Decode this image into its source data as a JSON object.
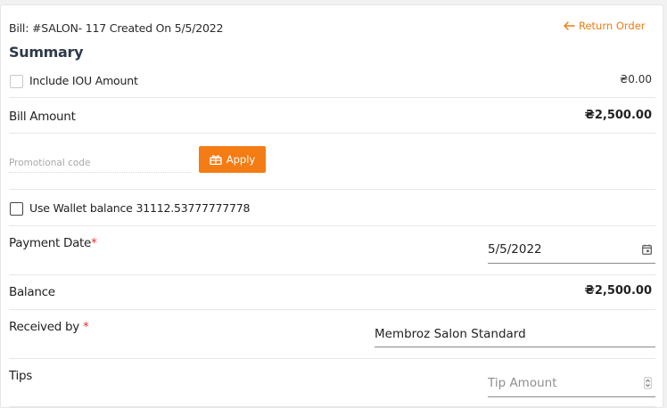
{
  "header": {
    "bill_info": "Bill: #SALON- 117 Created On 5/5/2022",
    "return_order": "Return Order"
  },
  "summary": {
    "title": "Summary",
    "iou": {
      "label": "Include IOU Amount",
      "amount": "₴0.00",
      "checked": false
    },
    "bill_amount": {
      "label": "Bill Amount",
      "value": "₴2,500.00"
    },
    "promo": {
      "placeholder": "Promotional code",
      "value": "",
      "apply_label": "Apply"
    },
    "wallet": {
      "label": "Use Wallet balance 31112.53777777778",
      "checked": false
    },
    "payment_date": {
      "label": "Payment Date",
      "required_mark": "*",
      "value": "5/5/2022"
    },
    "balance": {
      "label": "Balance",
      "value": "₴2,500.00"
    },
    "received_by": {
      "label": "Received by",
      "required_mark": "*",
      "value": "Membroz Salon Standard"
    },
    "tips": {
      "label": "Tips",
      "placeholder": "Tip Amount",
      "value": ""
    }
  },
  "colors": {
    "accent": "#f47c14",
    "required": "#e23232",
    "heading": "#2d3a4a"
  },
  "icons": {
    "return": "arrow-left-icon",
    "apply": "gift-icon",
    "date": "calendar-icon",
    "tips": "spinner-icon"
  }
}
